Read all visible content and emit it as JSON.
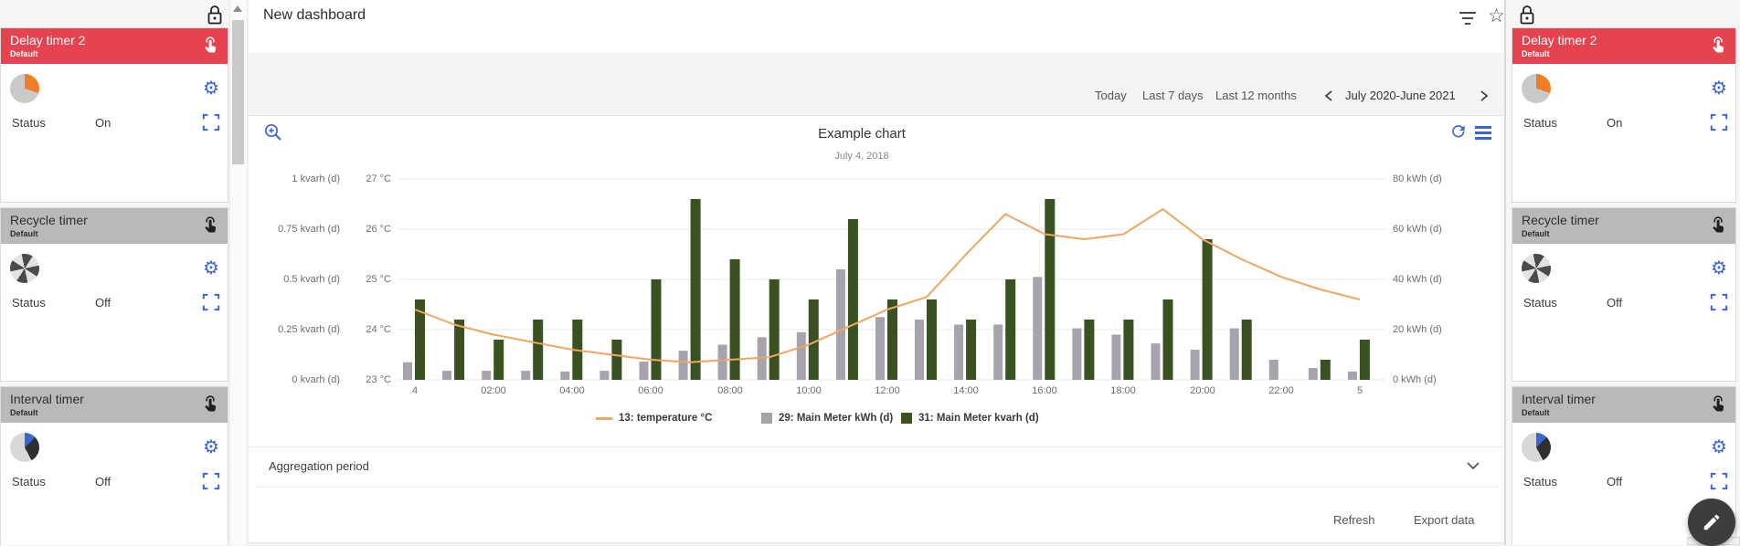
{
  "header": {
    "title": "New dashboard"
  },
  "sidebar": {
    "cards": [
      {
        "title": "Delay timer 2",
        "subtitle": "Default",
        "status_label": "Status",
        "status_value": "On"
      },
      {
        "title": "Recycle timer",
        "subtitle": "Default",
        "status_label": "Status",
        "status_value": "Off"
      },
      {
        "title": "Interval timer",
        "subtitle": "Default",
        "status_label": "Status",
        "status_value": "Off"
      }
    ]
  },
  "toolbar": {
    "quick_ranges": [
      "Today",
      "Last 7 days",
      "Last 12 months"
    ],
    "period_label": "July 2020-June 2021"
  },
  "chart_data": {
    "type": "mixed-bar-line",
    "title": "Example chart",
    "subtitle": "July 4, 2018",
    "series": [
      {
        "name": "13: temperature °C",
        "type": "line",
        "color": "#f0a662",
        "axis": "°C",
        "values": [
          24.4,
          24.1,
          23.9,
          23.75,
          23.6,
          23.5,
          23.4,
          23.35,
          23.4,
          23.45,
          23.7,
          24.05,
          24.4,
          24.65,
          25.5,
          26.3,
          25.9,
          25.8,
          25.9,
          26.4,
          25.8,
          25.4,
          25.05,
          24.8,
          24.6
        ]
      },
      {
        "name": "29: Main Meter kWh (d)",
        "type": "bar",
        "color": "#a6a3ac",
        "axis": "kWh (d)",
        "values": [
          7,
          3.6,
          3.6,
          3.6,
          3.3,
          3.6,
          7.3,
          11.6,
          14,
          17,
          19,
          44,
          25,
          24,
          22,
          22,
          41,
          20.5,
          18,
          14.5,
          12,
          20.5,
          8,
          4.7,
          3.3
        ]
      },
      {
        "name": "31: Main Meter kvarh (d)",
        "type": "bar",
        "color": "#3a5222",
        "axis": "kvarh (d)",
        "values": [
          0.4,
          0.3,
          0.2,
          0.3,
          0.3,
          0.2,
          0.5,
          0.9,
          0.6,
          0.5,
          0.4,
          0.8,
          0.4,
          0.4,
          0.3,
          0.5,
          0.9,
          0.3,
          0.3,
          0.4,
          0.7,
          0.3,
          0,
          0.1,
          0.2
        ]
      }
    ],
    "axis_left_kvarh": {
      "ticks": [
        "1 kvarh (d)",
        "0.75 kvarh (d)",
        "0.5 kvarh (d)",
        "0.25 kvarh (d)",
        "0 kvarh (d)"
      ],
      "range": [
        0,
        1
      ]
    },
    "axis_left_temp": {
      "ticks": [
        "27 °C",
        "26 °C",
        "25 °C",
        "24 °C",
        "23 °C"
      ],
      "range": [
        23,
        27
      ]
    },
    "axis_right_kwh": {
      "ticks": [
        "80 kWh (d)",
        "60 kWh (d)",
        "40 kWh (d)",
        "20 kWh (d)",
        "0 kWh (d)"
      ],
      "range": [
        0,
        80
      ]
    },
    "x_ticks": {
      "hours": [
        0,
        2,
        4,
        6,
        8,
        10,
        12,
        14,
        16,
        18,
        20,
        22,
        24
      ],
      "labels": [
        "4",
        "02:00",
        "04:00",
        "06:00",
        "08:00",
        "10:00",
        "12:00",
        "14:00",
        "16:00",
        "18:00",
        "20:00",
        "22:00",
        "5"
      ]
    },
    "grid": true,
    "legend_position": "bottom"
  },
  "aggregation": {
    "label": "Aggregation period"
  },
  "footer": {
    "refresh_label": "Refresh",
    "export_label": "Export data"
  },
  "colors": {
    "header_red": "#e5434f",
    "header_gray": "#b9b9b9",
    "icon_blue": "#3b66d1",
    "bar_gray": "#a6a3ac",
    "bar_green": "#3a5222",
    "line_orange": "#f0a662",
    "fab_dark": "#3d3d3d"
  }
}
